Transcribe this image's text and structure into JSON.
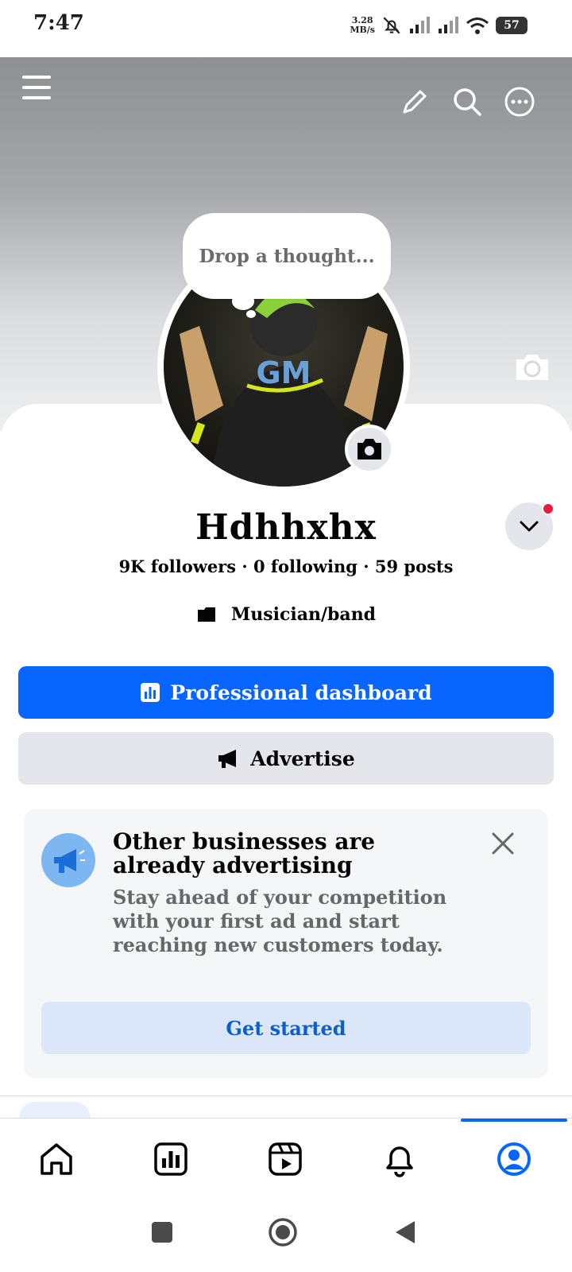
{
  "status_bar": {
    "time": "7:47",
    "net_speed_value": "3.28",
    "net_speed_unit": "MB/s",
    "battery": "57"
  },
  "cover": {
    "icons": [
      "menu-icon",
      "pencil-icon",
      "search-icon",
      "more-icon",
      "camera-icon"
    ]
  },
  "thought_bubble": {
    "placeholder": "Drop a thought..."
  },
  "profile": {
    "name": "Hdhhxhx",
    "stats": "9K followers · 0 following · 59 posts",
    "category": "Musician/band",
    "avatar_text": "GM"
  },
  "actions": {
    "primary_label": "Professional dashboard",
    "secondary_label": "Advertise"
  },
  "promo": {
    "title": "Other businesses are already advertising",
    "description": "Stay ahead of your competition with your first ad and start reaching new customers today.",
    "cta": "Get started"
  },
  "bottom_nav": {
    "items": [
      "home-icon",
      "dashboard-icon",
      "reels-icon",
      "bell-icon",
      "profile-icon"
    ],
    "active": "profile-icon"
  },
  "colors": {
    "accent": "#0866ff",
    "secondary_button": "#e4e6eb",
    "promo_cta_bg": "#dbe7f8",
    "promo_cta_text": "#0a5fc9",
    "notification_dot": "#e41e3f"
  }
}
